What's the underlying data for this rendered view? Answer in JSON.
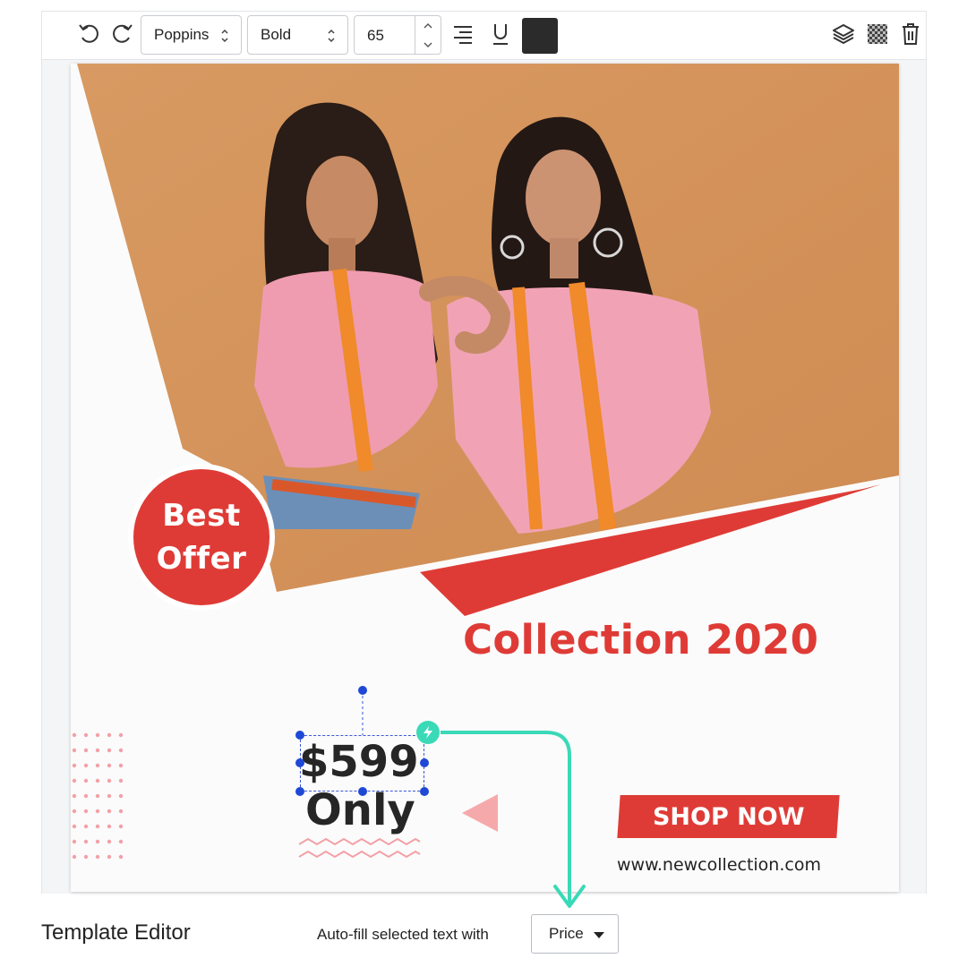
{
  "toolbar": {
    "font_family": "Poppins",
    "font_weight": "Bold",
    "font_size": "65",
    "text_color": "#2b2b2b",
    "icons": [
      "undo-icon",
      "redo-icon",
      "align-right-icon",
      "underline-icon",
      "layers-icon",
      "transparency-icon",
      "trash-icon"
    ]
  },
  "canvas": {
    "badge_line1": "Best",
    "badge_line2": "Offer",
    "headline": "Collection 2020",
    "price": "$599",
    "price_suffix": "Only",
    "cta": "SHOP NOW",
    "website": "www.newcollection.com",
    "accent_color": "#df3b36",
    "photo_bg": "#d99a62"
  },
  "footer": {
    "title": "Template Editor",
    "autofill_label": "Auto-fill selected text with",
    "autofill_value": "Price"
  },
  "highlight_color": "#3ad9b7"
}
